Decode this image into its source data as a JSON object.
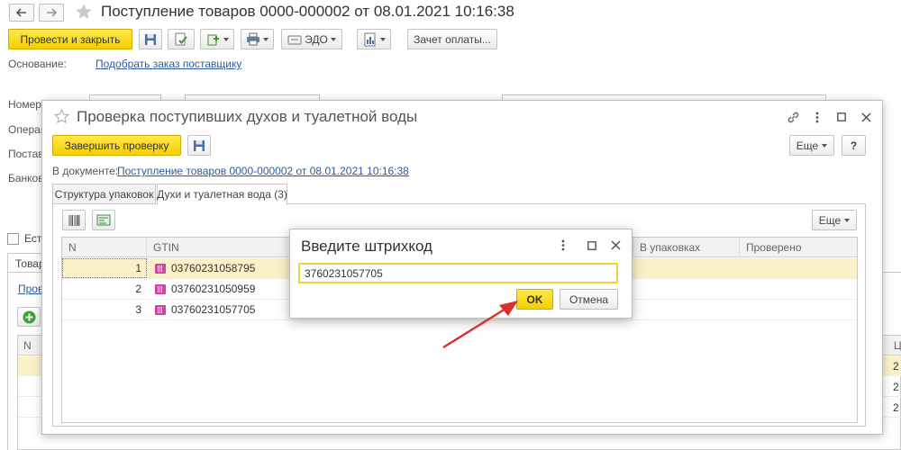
{
  "doc": {
    "title": "Поступление товаров 0000-000002 от 08.01.2021 10:16:38",
    "post_close_label": "Провести и закрыть",
    "edo_label": "ЭДО",
    "payment_offset_label": "Зачет оплаты...",
    "basis_label": "Основание:",
    "select_order_link": "Подобрать заказ поставщику",
    "number_label": "Номер:",
    "operation_label": "Операц",
    "supplier_label": "Постав",
    "bank_label": "Банков",
    "checkbox_label": "Ест",
    "tab_goods_label": "Товар",
    "check_link": "Пров",
    "table_n": "N",
    "right_col": "Ц",
    "right_rows": [
      "2",
      "2",
      "2"
    ]
  },
  "check_modal": {
    "title": "Проверка поступивших духов и туалетной воды",
    "finish_label": "Завершить проверку",
    "more_label": "Еще",
    "help_label": "?",
    "in_document_label": "В документе:",
    "document_link": "Поступление товаров 0000-000002 от 08.01.2021 10:16:38",
    "tabs": [
      {
        "label": "Структура упаковок"
      },
      {
        "label": "Духи и туалетная вода (3)"
      }
    ],
    "panel_more_label": "Еще",
    "columns": {
      "n": "N",
      "gtin": "GTIN",
      "in_packages": "В упаковках",
      "checked": "Проверено"
    },
    "rows": [
      {
        "n": "1",
        "gtin": "03760231058795"
      },
      {
        "n": "2",
        "gtin": "03760231050959"
      },
      {
        "n": "3",
        "gtin": "03760231057705"
      }
    ]
  },
  "barcode_dialog": {
    "title": "Введите штрихкод",
    "value": "3760231057705",
    "ok_label": "OK",
    "cancel_label": "Отмена"
  },
  "colors": {
    "accent_yellow": "#f5cf00",
    "selected_row": "#fbf1c9",
    "link_blue": "#2a5a9f",
    "arrow_red": "#d9302c"
  }
}
